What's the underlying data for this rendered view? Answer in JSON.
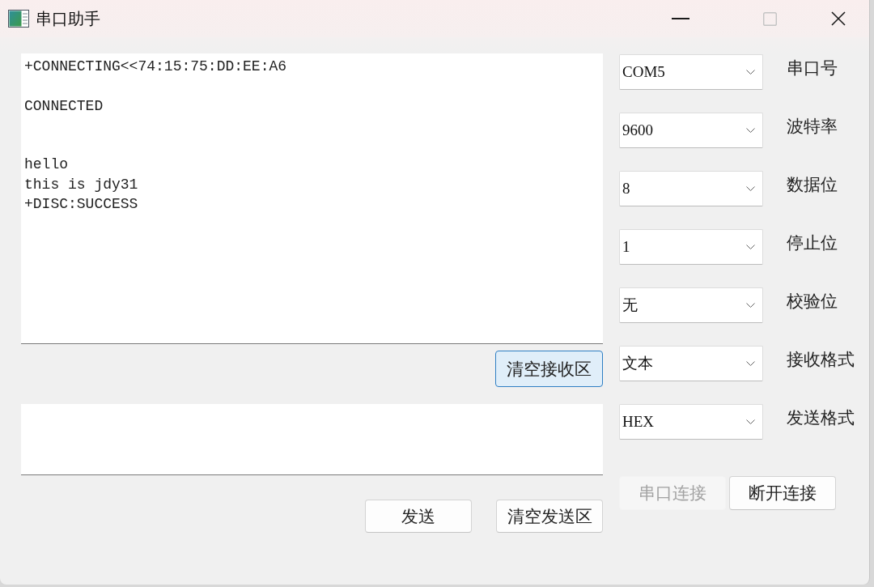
{
  "window": {
    "title": "串口助手",
    "controls": [
      {
        "kind": "minimize",
        "disabled": false
      },
      {
        "kind": "maximize",
        "disabled": true
      },
      {
        "kind": "close",
        "disabled": false
      }
    ]
  },
  "receive_area": {
    "value": "+CONNECTING<<74:15:75:DD:EE:A6\n\nCONNECTED\n\n\nhello\nthis is jdy31\n+DISC:SUCCESS"
  },
  "receive_buttons": [
    {
      "label": "清空接收区",
      "focused": true
    }
  ],
  "send_buttons": [
    {
      "label": "发送",
      "focused": false
    },
    {
      "label": "清空发送区",
      "focused": false
    }
  ],
  "settings": [
    {
      "label": "串口号",
      "value": "COM5"
    },
    {
      "label": "波特率",
      "value": "9600"
    },
    {
      "label": "数据位",
      "value": "8"
    },
    {
      "label": "停止位",
      "value": "1"
    },
    {
      "label": "校验位",
      "value": "无"
    },
    {
      "label": "接收格式",
      "value": "文本"
    },
    {
      "label": "发送格式",
      "value": "HEX"
    }
  ],
  "connection_buttons": [
    {
      "label": "串口连接",
      "disabled": true
    },
    {
      "label": "断开连接",
      "disabled": false
    }
  ]
}
